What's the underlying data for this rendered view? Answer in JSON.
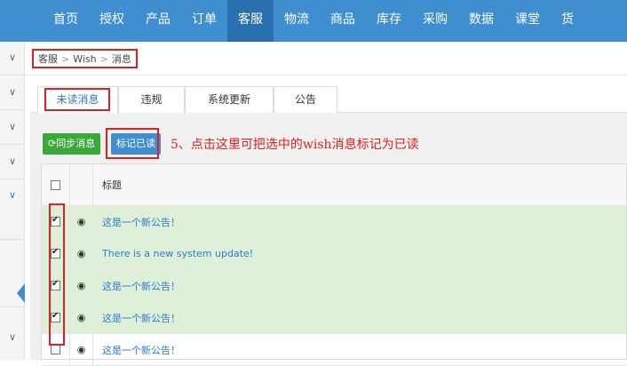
{
  "nav": {
    "items": [
      "首页",
      "授权",
      "产品",
      "订单",
      "客服",
      "物流",
      "商品",
      "库存",
      "采购",
      "数据",
      "课堂",
      "货"
    ],
    "active_index": 4
  },
  "breadcrumb": {
    "items": [
      "客服",
      "Wish",
      "消息"
    ],
    "separator": ">"
  },
  "tabs": [
    "未读消息",
    "违规",
    "系统更新",
    "公告"
  ],
  "toolbar": {
    "sync_label": "同步消息",
    "mark_read_label": "标记已读"
  },
  "annotation": "5、点击这里可把选中的wish消息标记为已读",
  "table": {
    "header": {
      "title": "标题"
    },
    "rows": [
      {
        "title": "这是一个新公告！",
        "checked": true,
        "highlighted": true
      },
      {
        "title": "There is a new system update!",
        "checked": true,
        "highlighted": true
      },
      {
        "title": "这是一个新公告！",
        "checked": true,
        "highlighted": true
      },
      {
        "title": "这是一个新公告！",
        "checked": true,
        "highlighted": true
      },
      {
        "title": "这是一个新公告！",
        "checked": false,
        "highlighted": false
      }
    ]
  },
  "icons": {
    "sync": "refresh-icon",
    "view": "eye-icon",
    "sidebar": "chevron-down-icon"
  },
  "colors": {
    "nav_bg": "#3e8ed0",
    "nav_active": "#2a6fb0",
    "highlight_red": "#e02020",
    "row_green": "#dff0d8",
    "sync_green": "#3aa93a"
  }
}
